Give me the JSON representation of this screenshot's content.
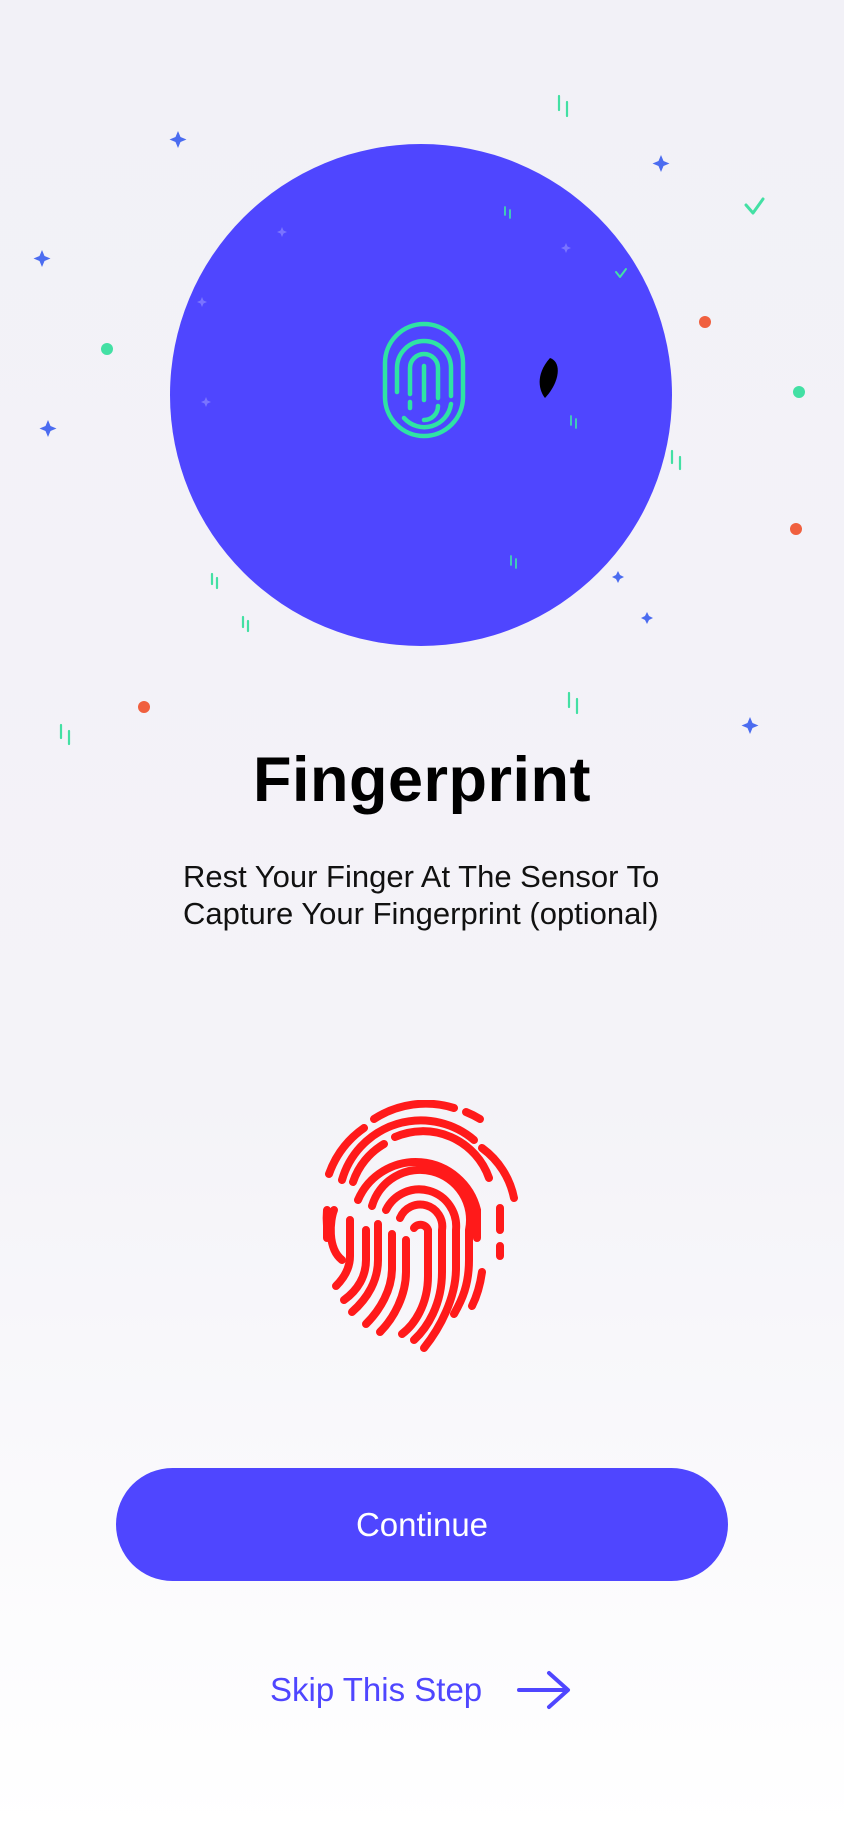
{
  "onboarding": {
    "title": "Fingerprint",
    "description": "Rest Your Finger At The Sensor To Capture Your Fingerprint (optional)"
  },
  "actions": {
    "continue_label": "Continue",
    "skip_label": "Skip This Step"
  },
  "icons": {
    "illustration_fingerprint": "fingerprint-icon",
    "main_fingerprint": "fingerprint-icon",
    "skip_arrow": "arrow-right-icon"
  },
  "colors": {
    "accent": "#4f46ff",
    "illustration_circle": "#4f46ff",
    "illustration_fingerprint": "#2fe3a4",
    "main_fingerprint": "#ff1a1a",
    "confetti_orange": "#f0603f",
    "confetti_green": "#43e0a4",
    "confetti_blue": "#4b6cf0"
  }
}
